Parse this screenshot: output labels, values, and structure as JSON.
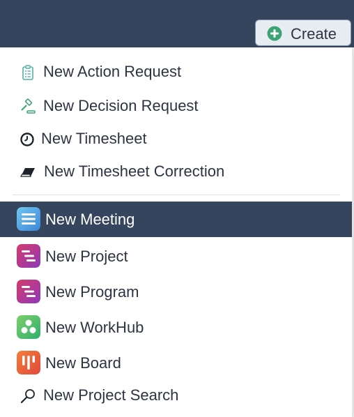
{
  "header": {
    "create_label": "Create",
    "create_icon": "plus-circle-icon"
  },
  "menu": {
    "items": [
      {
        "label": "New Action Request",
        "icon": "clipboard-icon"
      },
      {
        "label": "New Decision Request",
        "icon": "gavel-icon"
      },
      {
        "label": "New Timesheet",
        "icon": "clock-icon"
      },
      {
        "label": "New Timesheet Correction",
        "icon": "eraser-icon"
      },
      {
        "label": "New Meeting",
        "icon": "meeting-app-icon",
        "selected": true
      },
      {
        "label": "New Project",
        "icon": "project-app-icon"
      },
      {
        "label": "New Program",
        "icon": "program-app-icon"
      },
      {
        "label": "New WorkHub",
        "icon": "workhub-app-icon"
      },
      {
        "label": "New Board",
        "icon": "board-app-icon"
      },
      {
        "label": "New Project Search",
        "icon": "magnifier-icon"
      }
    ]
  },
  "colors": {
    "topbar": "#34455d",
    "selected_bg": "#34455d",
    "accent_green": "#3ba374"
  }
}
